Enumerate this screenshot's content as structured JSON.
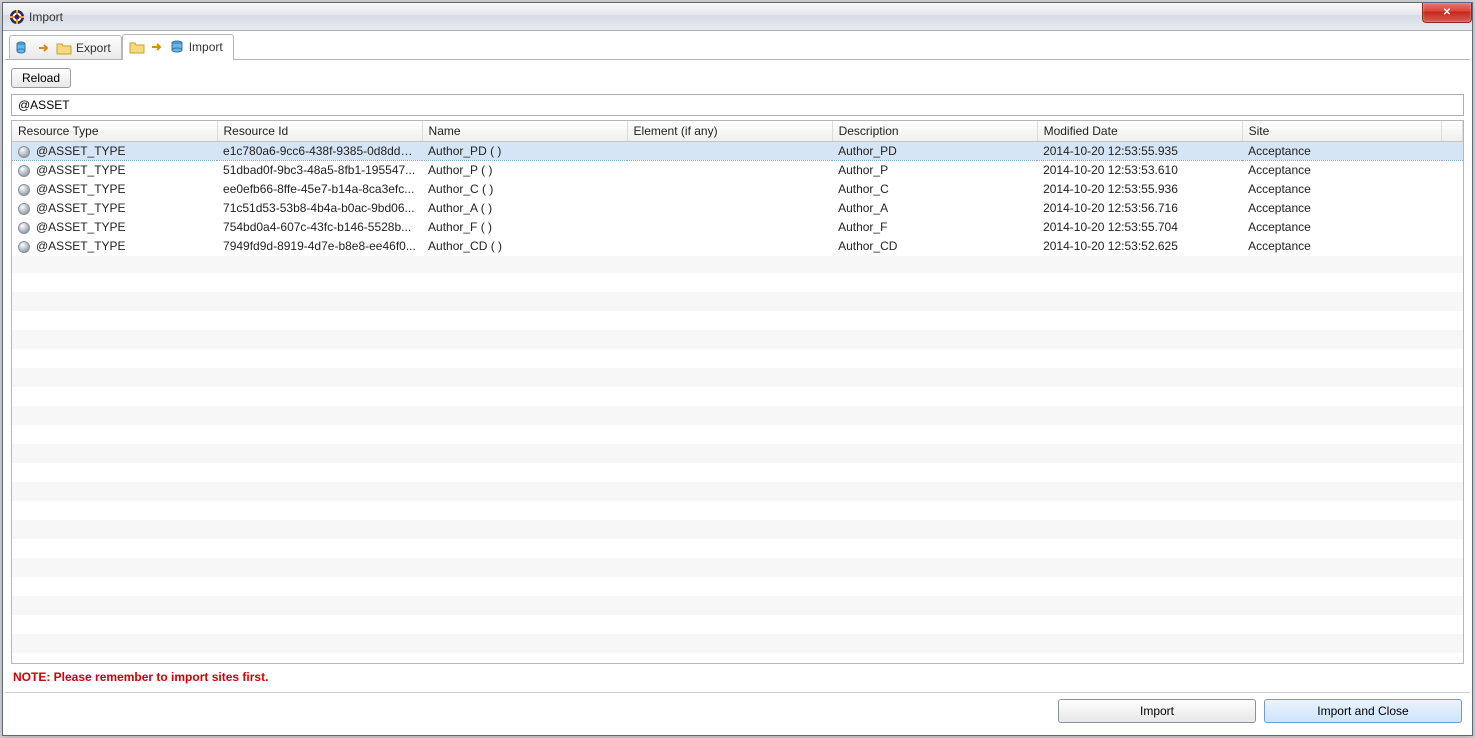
{
  "window": {
    "title": "Import",
    "close_label": "✕"
  },
  "tabs": {
    "export_label": "Export",
    "import_label": "Import"
  },
  "toolbar": {
    "reload_label": "Reload"
  },
  "filter": {
    "value": "@ASSET"
  },
  "columns": {
    "c0": "Resource Type",
    "c1": "Resource Id",
    "c2": "Name",
    "c3": "Element (if any)",
    "c4": "Description",
    "c5": "Modified Date",
    "c6": "Site"
  },
  "rows": [
    {
      "type": "@ASSET_TYPE",
      "id": "e1c780a6-9cc6-438f-9385-0d8dd9...",
      "name": "Author_PD ( )",
      "element": "",
      "desc": "Author_PD",
      "mod": "2014-10-20 12:53:55.935",
      "site": "Acceptance"
    },
    {
      "type": "@ASSET_TYPE",
      "id": "51dbad0f-9bc3-48a5-8fb1-195547...",
      "name": "Author_P ( )",
      "element": "",
      "desc": "Author_P",
      "mod": "2014-10-20 12:53:53.610",
      "site": "Acceptance"
    },
    {
      "type": "@ASSET_TYPE",
      "id": "ee0efb66-8ffe-45e7-b14a-8ca3efc...",
      "name": "Author_C ( )",
      "element": "",
      "desc": "Author_C",
      "mod": "2014-10-20 12:53:55.936",
      "site": "Acceptance"
    },
    {
      "type": "@ASSET_TYPE",
      "id": "71c51d53-53b8-4b4a-b0ac-9bd06...",
      "name": "Author_A ( )",
      "element": "",
      "desc": "Author_A",
      "mod": "2014-10-20 12:53:56.716",
      "site": "Acceptance"
    },
    {
      "type": "@ASSET_TYPE",
      "id": "754bd0a4-607c-43fc-b146-5528b...",
      "name": "Author_F ( )",
      "element": "",
      "desc": "Author_F",
      "mod": "2014-10-20 12:53:55.704",
      "site": "Acceptance"
    },
    {
      "type": "@ASSET_TYPE",
      "id": "7949fd9d-8919-4d7e-b8e8-ee46f0...",
      "name": "Author_CD ( )",
      "element": "",
      "desc": "Author_CD",
      "mod": "2014-10-20 12:53:52.625",
      "site": "Acceptance"
    }
  ],
  "note": "NOTE: Please remember to import sites first.",
  "footer": {
    "import_label": "Import",
    "import_close_label": "Import and Close"
  }
}
